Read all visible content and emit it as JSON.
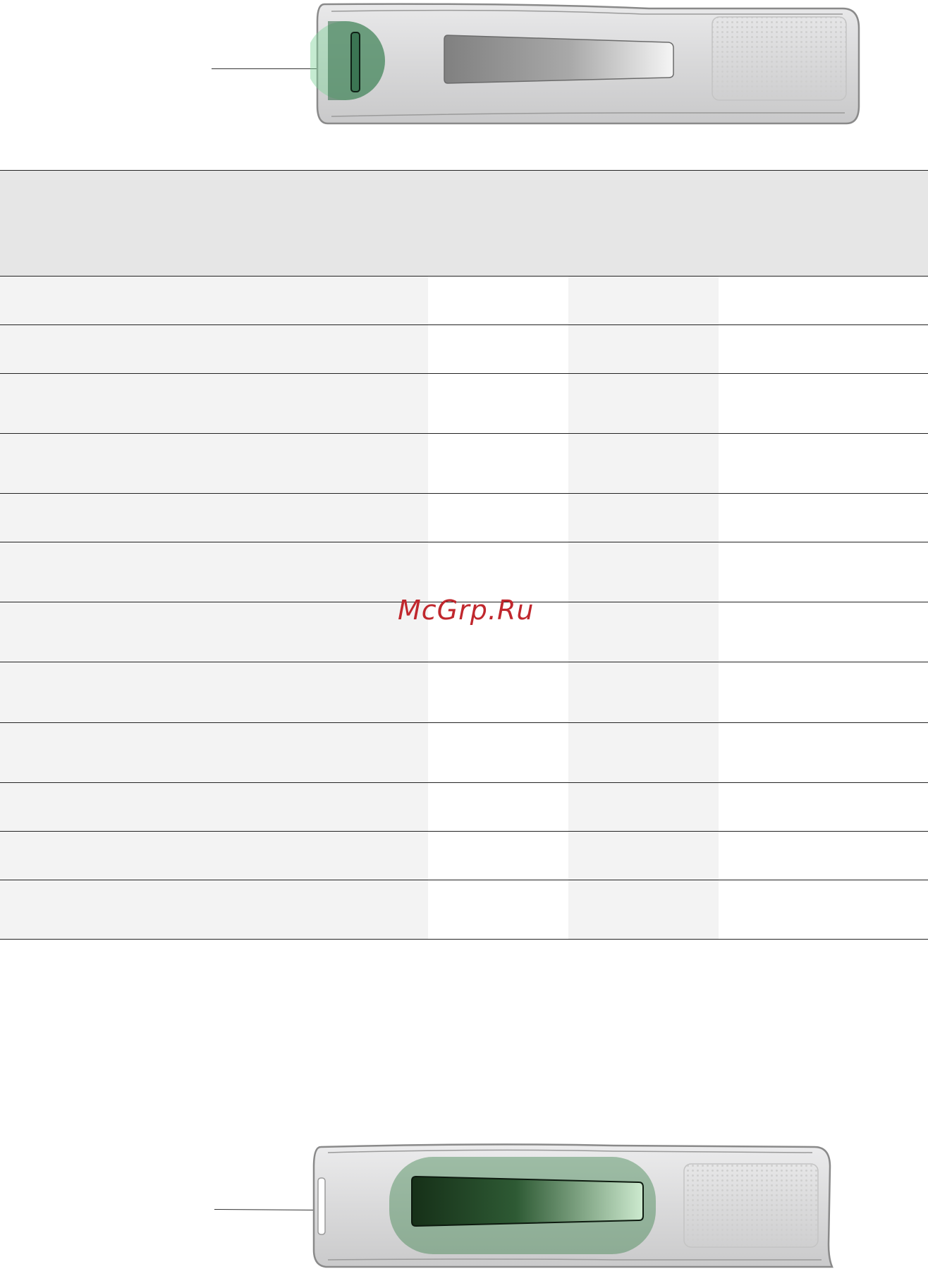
{
  "watermark": {
    "text": "McGrp.Ru",
    "color": "#c0272d"
  },
  "figures": [
    {
      "name": "device-top",
      "highlight": "left-end-port",
      "highlight_color": "#7fd39a"
    },
    {
      "name": "device-bottom",
      "highlight": "center-slider-window",
      "highlight_color": "#2e7a3e"
    }
  ],
  "table": {
    "columns": 4,
    "rows": [
      [
        "",
        "",
        "",
        ""
      ],
      [
        "",
        "",
        "",
        ""
      ],
      [
        "",
        "",
        "",
        ""
      ],
      [
        "",
        "",
        "",
        ""
      ],
      [
        "",
        "",
        "",
        ""
      ],
      [
        "",
        "",
        "",
        ""
      ],
      [
        "",
        "",
        "",
        ""
      ],
      [
        "",
        "",
        "",
        ""
      ],
      [
        "",
        "",
        "",
        ""
      ],
      [
        "",
        "",
        "",
        ""
      ],
      [
        "",
        "",
        "",
        ""
      ],
      [
        "",
        "",
        "",
        ""
      ]
    ]
  }
}
